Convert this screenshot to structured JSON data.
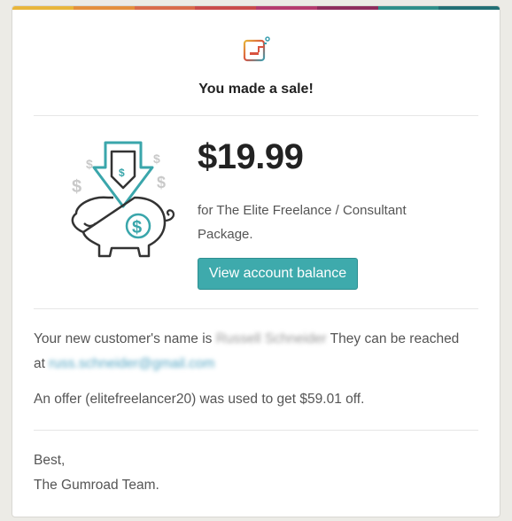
{
  "header": {
    "headline": "You made a sale!"
  },
  "sale": {
    "amount": "$19.99",
    "product_text": "for The Elite Freelance / Consultant Package.",
    "button_label": "View account balance"
  },
  "customer": {
    "name_prefix": "Your new customer's name is",
    "name_value": "Russell Schneider",
    "reach_text": " They can be reached",
    "at_text": "at",
    "email_value": "russ.schneider@gmail.com"
  },
  "offer": {
    "text": "An offer (elitefreelancer20) was used to get $59.01 off."
  },
  "signoff": {
    "line1": "Best,",
    "line2": "The Gumroad Team."
  },
  "colors": {
    "accent": "#3eaaac",
    "stripe": [
      "#e8b53a",
      "#e48f3d",
      "#d96b4b",
      "#c94b4b",
      "#b53b6f",
      "#8e2d5e",
      "#2f8f8a",
      "#226f74"
    ]
  }
}
